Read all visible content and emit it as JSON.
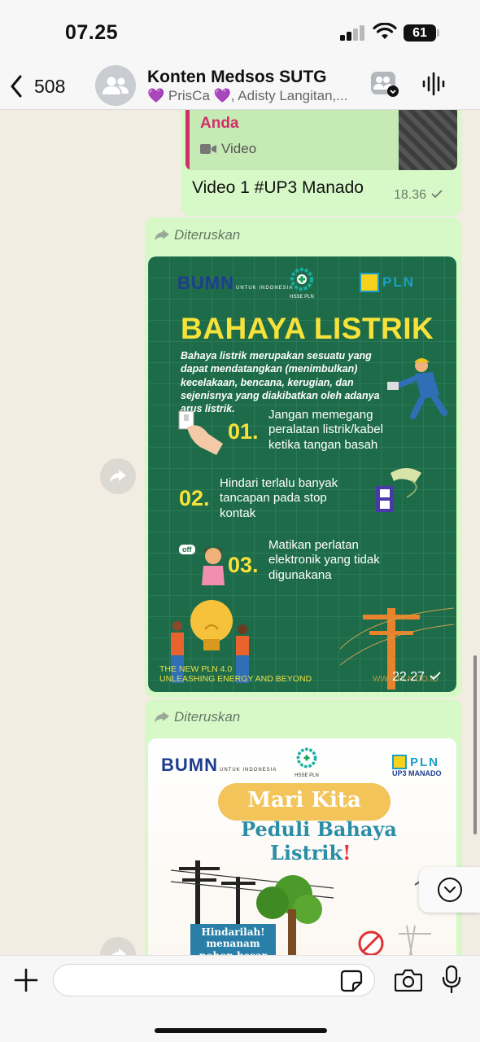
{
  "status_bar": {
    "time": "07.25",
    "battery": "61",
    "signal_bars": 2
  },
  "header": {
    "back_count": "508",
    "title": "Konten Medsos SUTG",
    "subtitle": "💜 PrisCa 💜, Adisty Langitan,...",
    "icons": [
      "chevron-left-icon",
      "group-avatar-icon",
      "community-icon",
      "voice-call-icon"
    ]
  },
  "messages": [
    {
      "quote_author": "Anda",
      "quote_type": "Video",
      "text": "Video 1 #UP3 Manado",
      "time": "18.36"
    },
    {
      "forwarded_label": "Diteruskan",
      "time": "22.27",
      "poster": {
        "logo_bumn": "BUMN",
        "logo_bumn_sub": "UNTUK INDONESIA",
        "logo_hsse": "HSSE PLN",
        "logo_pln": "PLN",
        "title": "BAHAYA LISTRIK",
        "intro": "Bahaya listrik merupakan sesuatu yang dapat mendatangkan (menimbulkan) kecelakaan, bencana, kerugian, dan sejenisnya yang diakibatkan oleh adanya arus listrik.",
        "tips": [
          {
            "num": "01.",
            "text": "Jangan memegang peralatan listrik/kabel ketika tangan basah"
          },
          {
            "num": "02.",
            "text": "Hindari terlalu banyak tancapan pada stop kontak"
          },
          {
            "num": "03.",
            "text": "Matikan perlatan elektronik yang tidak digunakana"
          }
        ],
        "footer_line1": "THE NEW PLN 4.0",
        "footer_line2": "UNLEASHING ENERGY AND BEYOND",
        "footer_url": "WWW.PLN.CO.ID",
        "off_label": "off"
      }
    },
    {
      "forwarded_label": "Diteruskan",
      "poster": {
        "logo_bumn": "BUMN",
        "logo_bumn_sub": "UNTUK INDONESIA",
        "logo_hsse": "HSSE PLN",
        "logo_pln": "PLN",
        "logo_pln_sub": "UP3 MANADO",
        "line1": "Mari Kita",
        "line2": "Peduli Bahaya",
        "line3": "Listrik",
        "note": "Hindarilah! menanam pohon besar dekat"
      }
    }
  ],
  "input": {
    "placeholder": ""
  },
  "colors": {
    "bubble": "#d7f9c8",
    "quote_author": "#d12e6a",
    "poster_green": "#1e6b4a",
    "poster_yellow": "#f7e23a",
    "poster_blue": "#2b8ea5"
  }
}
